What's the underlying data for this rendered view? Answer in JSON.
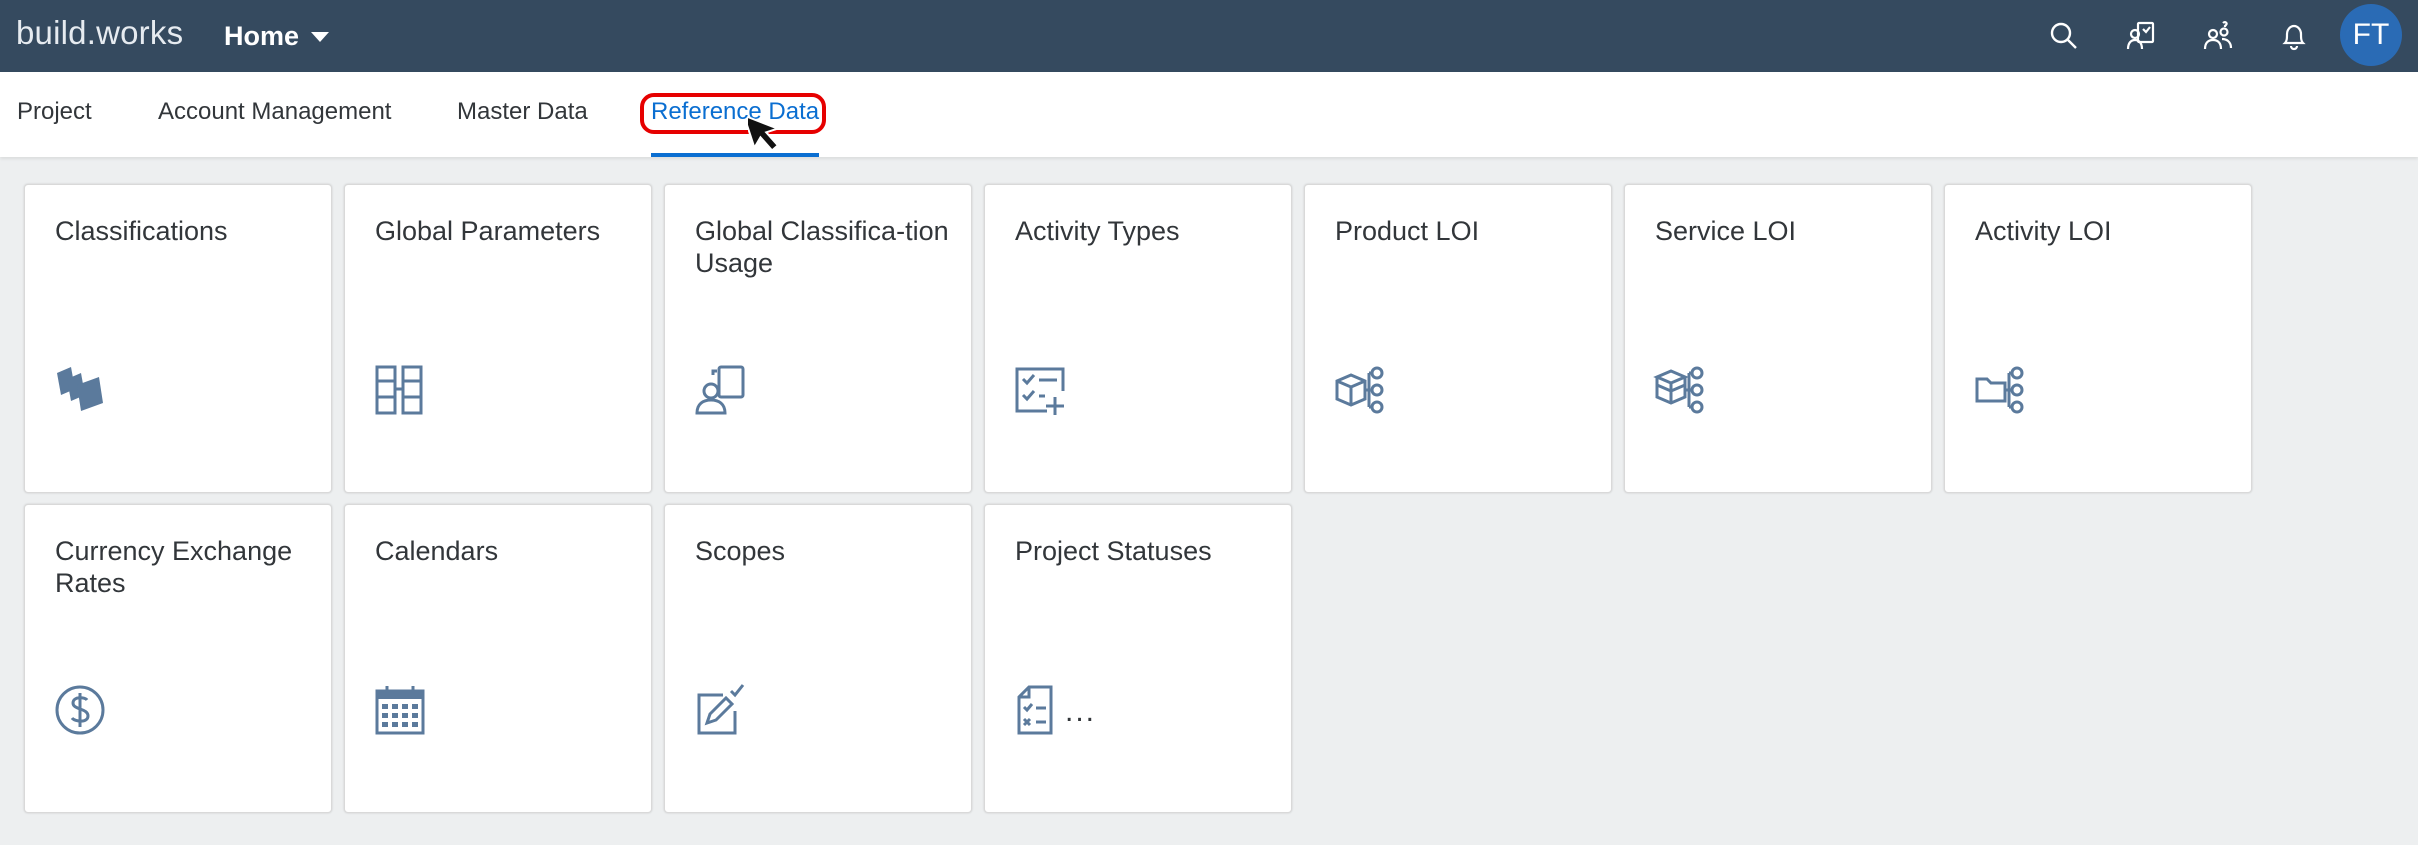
{
  "shell": {
    "brand": "build.works",
    "home_menu": "Home",
    "avatar_initials": "FT",
    "accent": "#354a5f",
    "avatar_color": "#2a6bb5"
  },
  "tabs": [
    {
      "label": "Project",
      "selected": false
    },
    {
      "label": "Account Management",
      "selected": false
    },
    {
      "label": "Master Data",
      "selected": false
    },
    {
      "label": "Reference Data",
      "selected": true
    }
  ],
  "tiles": [
    {
      "title": "Classifications",
      "icon": "stacked-layers-icon"
    },
    {
      "title": "Global Parameters",
      "icon": "grid-parameters-icon"
    },
    {
      "title": "Global Classifica-tion Usage",
      "icon": "user-documents-icon"
    },
    {
      "title": "Activity Types",
      "icon": "checklist-add-icon"
    },
    {
      "title": "Product LOI",
      "icon": "cube-hierarchy-icon"
    },
    {
      "title": "Service LOI",
      "icon": "box-hierarchy-icon"
    },
    {
      "title": "Activity LOI",
      "icon": "folder-hierarchy-icon"
    },
    {
      "title": "Currency Exchange Rates",
      "icon": "dollar-circle-icon"
    },
    {
      "title": "Calendars",
      "icon": "calendar-icon"
    },
    {
      "title": "Scopes",
      "icon": "edit-check-icon"
    },
    {
      "title": "Project Statuses",
      "icon": "document-checklist-icon",
      "extra": "..."
    }
  ]
}
